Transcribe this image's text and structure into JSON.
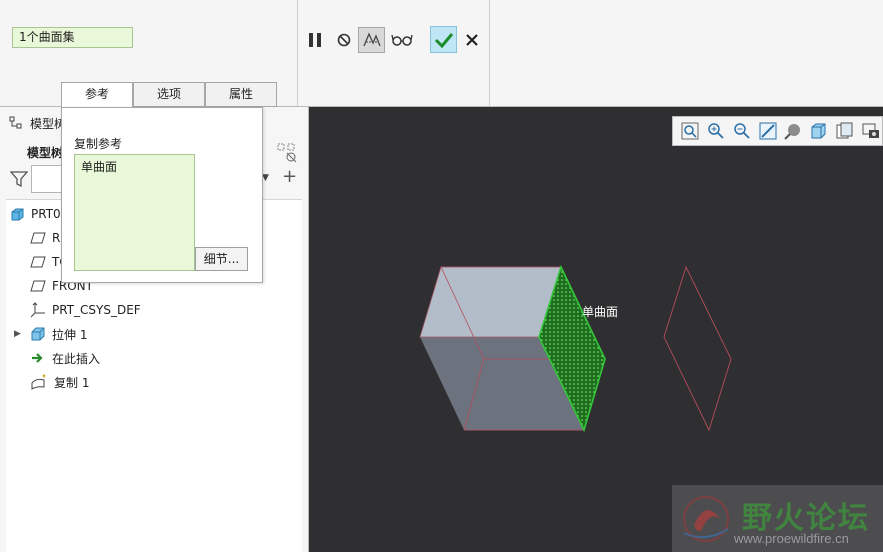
{
  "dashboard": {
    "collector_value": "1个曲面集",
    "tabs": [
      {
        "label": "参考",
        "active": true
      },
      {
        "label": "选项",
        "active": false
      },
      {
        "label": "属性",
        "active": false
      }
    ],
    "tools": [
      "pause-icon",
      "no-preview-icon",
      "feature-preview-icon",
      "glasses-icon",
      "ok-check-icon",
      "cancel-x-icon"
    ]
  },
  "reference_popup": {
    "title": "复制参考",
    "items": [
      "单曲面"
    ],
    "details_button": "细节..."
  },
  "model_tree": {
    "panel_title": "模型树",
    "header": "模型树",
    "items": [
      {
        "label": "PRT0001.PRT",
        "icon": "part-icon",
        "indent": 0
      },
      {
        "label": "RIGHT",
        "icon": "datum-plane-icon",
        "indent": 1
      },
      {
        "label": "TOP",
        "icon": "datum-plane-icon",
        "indent": 1
      },
      {
        "label": "FRONT",
        "icon": "datum-plane-icon",
        "indent": 1
      },
      {
        "label": "PRT_CSYS_DEF",
        "icon": "csys-icon",
        "indent": 1
      },
      {
        "label": "拉伸 1",
        "icon": "extrude-icon",
        "indent": 1,
        "expandable": true
      },
      {
        "label": "在此插入",
        "icon": "insert-here-arrow-icon",
        "indent": 1
      },
      {
        "label": "复制 1",
        "icon": "copy-surface-icon",
        "indent": 1
      }
    ]
  },
  "graphics": {
    "selected_label": "单曲面",
    "background": "#2f2f32",
    "highlight_color": "#34c63a",
    "view_tools": [
      "refit-icon",
      "zoom-in-icon",
      "zoom-out-icon",
      "repaint-icon",
      "display-style-icon",
      "saved-views-icon",
      "view-manager-icon",
      "datum-display-icon"
    ]
  },
  "watermark": {
    "title": "野火论坛",
    "url": "www.proewildfire.cn"
  }
}
